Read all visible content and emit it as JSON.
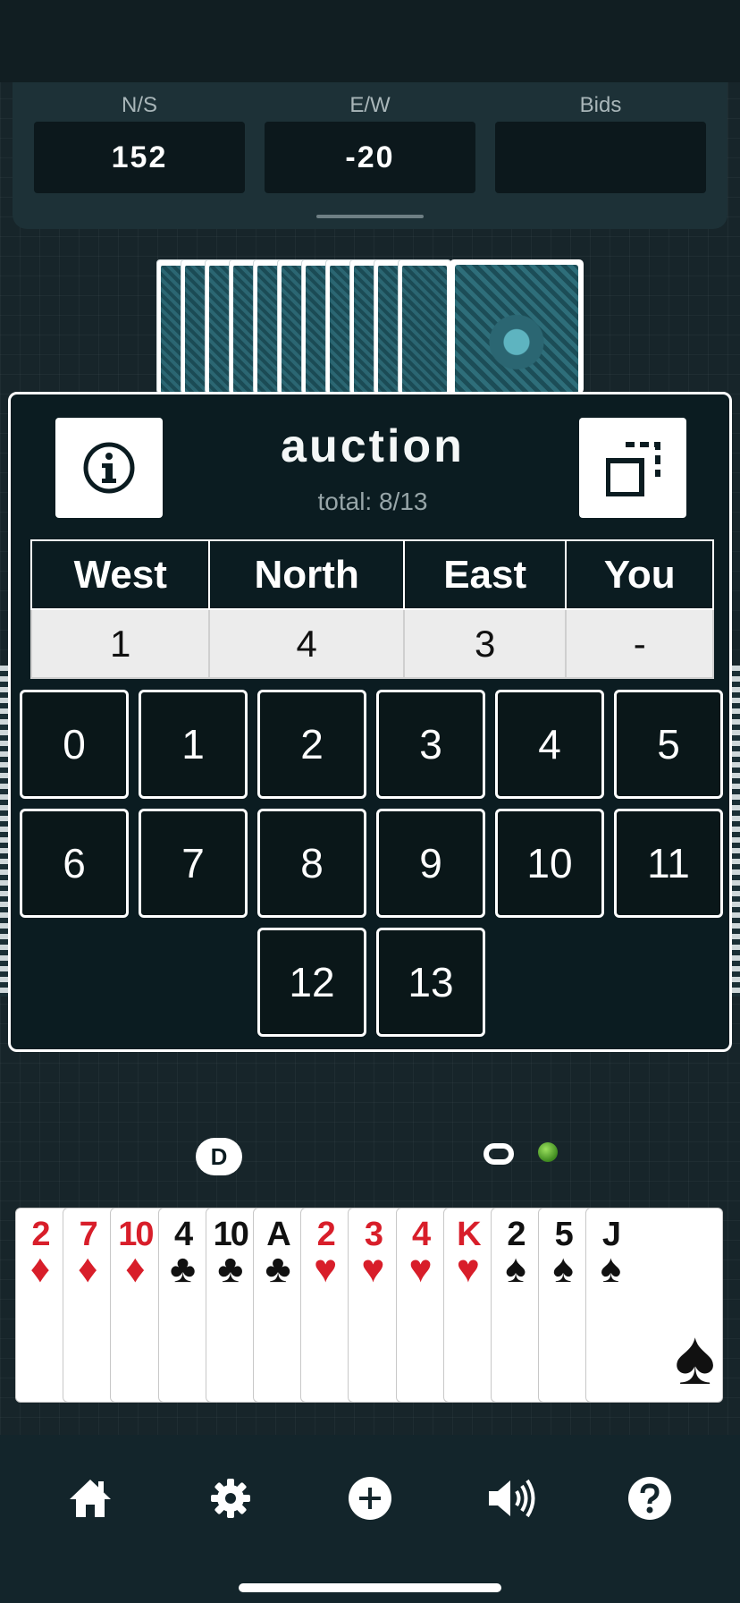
{
  "score": {
    "columns": [
      {
        "label": "N/S",
        "value": "152"
      },
      {
        "label": "E/W",
        "value": "-20"
      },
      {
        "label": "Bids",
        "value": ""
      }
    ]
  },
  "auction": {
    "title": "auction",
    "total": "total: 8/13",
    "headers": [
      "West",
      "North",
      "East",
      "You"
    ],
    "bids": [
      "1",
      "4",
      "3",
      "-"
    ],
    "options": [
      "0",
      "1",
      "2",
      "3",
      "4",
      "5",
      "6",
      "7",
      "8",
      "9",
      "10",
      "11",
      "12",
      "13"
    ]
  },
  "markers": {
    "dealer": "D"
  },
  "hand": [
    {
      "rank": "2",
      "suit": "♦",
      "color": "#d81e2a"
    },
    {
      "rank": "7",
      "suit": "♦",
      "color": "#d81e2a"
    },
    {
      "rank": "10",
      "suit": "♦",
      "color": "#d81e2a"
    },
    {
      "rank": "4",
      "suit": "♣",
      "color": "#111111"
    },
    {
      "rank": "10",
      "suit": "♣",
      "color": "#111111"
    },
    {
      "rank": "A",
      "suit": "♣",
      "color": "#111111"
    },
    {
      "rank": "2",
      "suit": "♥",
      "color": "#d81e2a"
    },
    {
      "rank": "3",
      "suit": "♥",
      "color": "#d81e2a"
    },
    {
      "rank": "4",
      "suit": "♥",
      "color": "#d81e2a"
    },
    {
      "rank": "K",
      "suit": "♥",
      "color": "#d81e2a"
    },
    {
      "rank": "2",
      "suit": "♠",
      "color": "#111111"
    },
    {
      "rank": "5",
      "suit": "♠",
      "color": "#111111"
    },
    {
      "rank": "J",
      "suit": "♠",
      "color": "#111111"
    }
  ],
  "nav": [
    "home-icon",
    "gear-icon",
    "plus-icon",
    "speaker-icon",
    "help-icon"
  ]
}
